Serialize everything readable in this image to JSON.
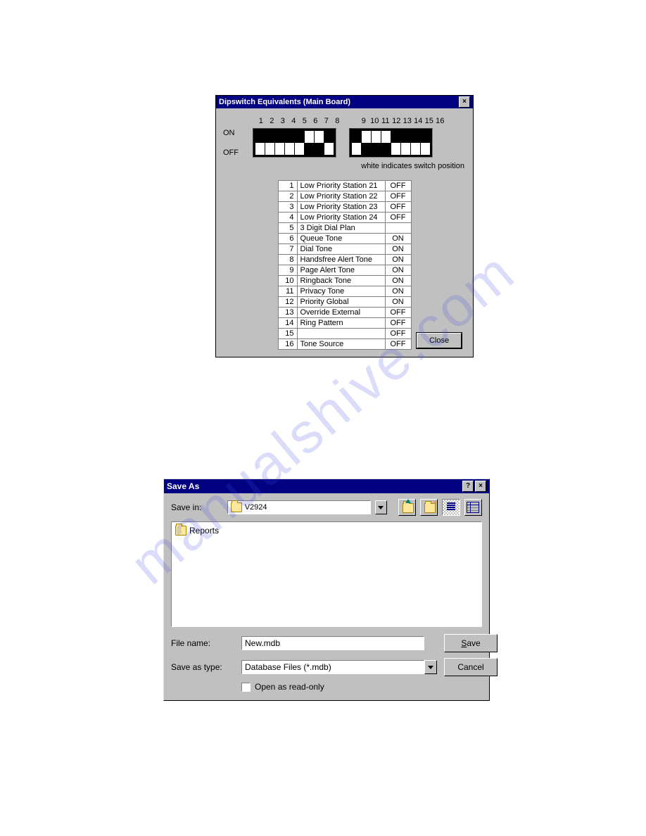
{
  "watermark": "manualshive.com",
  "dipswitch_dialog": {
    "title": "Dipswitch Equivalents (Main Board)",
    "on_label": "ON",
    "off_label": "OFF",
    "numbers_a": [
      "1",
      "2",
      "3",
      "4",
      "5",
      "6",
      "7",
      "8"
    ],
    "numbers_b": [
      "9",
      "10",
      "11",
      "12",
      "13",
      "14",
      "15",
      "16"
    ],
    "caption": "white indicates switch position",
    "switches": [
      "OFF",
      "OFF",
      "OFF",
      "OFF",
      "OFF",
      "ON",
      "ON",
      "OFF",
      "OFF",
      "ON",
      "ON",
      "ON",
      "OFF",
      "OFF",
      "OFF",
      "OFF"
    ],
    "rows": [
      {
        "n": "1",
        "label": "Low Priority Station 21",
        "state": "OFF"
      },
      {
        "n": "2",
        "label": "Low Priority Station 22",
        "state": "OFF"
      },
      {
        "n": "3",
        "label": "Low Priority Station 23",
        "state": "OFF"
      },
      {
        "n": "4",
        "label": "Low Priority Station 24",
        "state": "OFF"
      },
      {
        "n": "5",
        "label": "3 Digit Dial Plan",
        "state": ""
      },
      {
        "n": "6",
        "label": "Queue Tone",
        "state": "ON"
      },
      {
        "n": "7",
        "label": "Dial Tone",
        "state": "ON"
      },
      {
        "n": "8",
        "label": "Handsfree Alert Tone",
        "state": "ON"
      },
      {
        "n": "9",
        "label": "Page Alert Tone",
        "state": "ON"
      },
      {
        "n": "10",
        "label": "Ringback Tone",
        "state": "ON"
      },
      {
        "n": "11",
        "label": "Privacy Tone",
        "state": "ON"
      },
      {
        "n": "12",
        "label": "Priority Global",
        "state": "ON"
      },
      {
        "n": "13",
        "label": "Override External",
        "state": "OFF"
      },
      {
        "n": "14",
        "label": "Ring Pattern",
        "state": "OFF"
      },
      {
        "n": "15",
        "label": "",
        "state": "OFF"
      },
      {
        "n": "16",
        "label": "Tone Source",
        "state": "OFF"
      }
    ],
    "close_button": "Close",
    "close_x": "×"
  },
  "save_dialog": {
    "title": "Save As",
    "help_q": "?",
    "close_x": "×",
    "save_in_label": "Save in:",
    "save_in_value": "V2924",
    "folder_item": "Reports",
    "filename_label": "File name:",
    "filename_value": "New.mdb",
    "saveastype_label": "Save as type:",
    "saveastype_value": "Database Files (*.mdb)",
    "readonly_label": "Open as read-only",
    "save_button_prefix": "S",
    "save_button_rest": "ave",
    "cancel_button": "Cancel"
  }
}
